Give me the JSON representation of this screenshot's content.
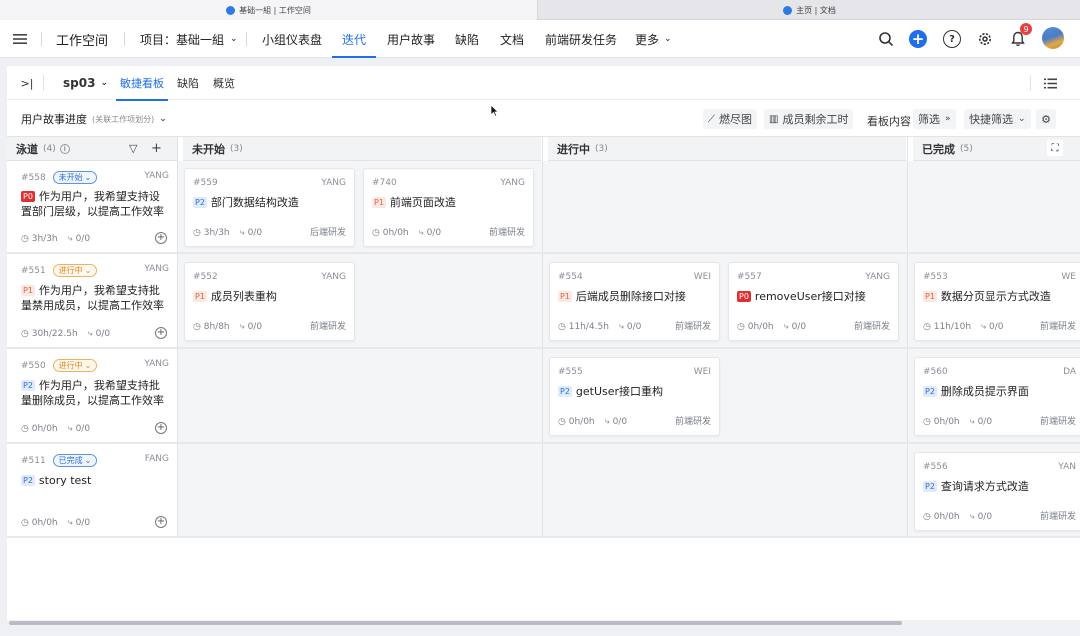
{
  "browser_tabs": [
    {
      "title": "基础一組 | 工作空间"
    },
    {
      "title": "主页 | 文档"
    }
  ],
  "header": {
    "app_title": "工作空间",
    "project_label": "项目：基础一組",
    "nav": [
      {
        "label": "小组仪表盘"
      },
      {
        "label": "迭代"
      },
      {
        "label": "用户故事"
      },
      {
        "label": "缺陷"
      },
      {
        "label": "文档"
      },
      {
        "label": "前端研发任务"
      },
      {
        "label": "更多"
      }
    ],
    "notification_count": "9"
  },
  "subnav": {
    "sprint": "sp03",
    "tabs": [
      {
        "label": "敏捷看板"
      },
      {
        "label": "缺陷"
      },
      {
        "label": "概览"
      }
    ]
  },
  "toolbar": {
    "view_title": "用户故事进度",
    "view_subtitle": "(关联工作项划分)",
    "burndown": "燃尽图",
    "remaining_hours": "成员剩余工时",
    "board_content_label": "看板内容",
    "filter": "筛选",
    "quick_filter": "快捷筛选"
  },
  "board": {
    "lane_header": {
      "label": "泳道",
      "count": "(4)"
    },
    "columns": [
      {
        "label": "未开始",
        "count": "(3)"
      },
      {
        "label": "进行中",
        "count": "(3)"
      },
      {
        "label": "已完成",
        "count": "(5)"
      }
    ],
    "lanes": [
      {
        "id": "#558",
        "status": "未开始",
        "owner": "YANG",
        "priority": "P0",
        "title": "作为用户，我希望支持设置部门层级，以提高工作效率",
        "hours": "3h/3h",
        "subtasks": "0/0"
      },
      {
        "id": "#551",
        "status": "进行中",
        "owner": "YANG",
        "priority": "P1",
        "title": "作为用户，我希望支持批量禁用成员，以提高工作效率",
        "hours": "30h/22.5h",
        "subtasks": "0/0"
      },
      {
        "id": "#550",
        "status": "进行中",
        "owner": "YANG",
        "priority": "P2",
        "title": "作为用户，我希望支持批量删除成员，以提高工作效率",
        "hours": "0h/0h",
        "subtasks": "0/0"
      },
      {
        "id": "#511",
        "status": "已完成",
        "owner": "FANG",
        "priority": "P2",
        "title": "story test",
        "hours": "0h/0h",
        "subtasks": "0/0"
      }
    ],
    "cards": [
      {
        "id": "#559",
        "owner": "YANG",
        "priority": "P2",
        "title": "部门数据结构改造",
        "hours": "3h/3h",
        "subtasks": "0/0",
        "team": "后端研发"
      },
      {
        "id": "#740",
        "owner": "YANG",
        "priority": "P1",
        "title": "前端页面改造",
        "hours": "0h/0h",
        "subtasks": "0/0",
        "team": "前端研发"
      },
      {
        "id": "#552",
        "owner": "YANG",
        "priority": "P1",
        "title": "成员列表重构",
        "hours": "8h/8h",
        "subtasks": "0/0",
        "team": "前端研发"
      },
      {
        "id": "#554",
        "owner": "WEI",
        "priority": "P1",
        "title": "后端成员删除接口对接",
        "hours": "11h/4.5h",
        "subtasks": "0/0",
        "team": "前端研发"
      },
      {
        "id": "#557",
        "owner": "YANG",
        "priority": "P0",
        "title": "removeUser接口对接",
        "hours": "0h/0h",
        "subtasks": "0/0",
        "team": "前端研发"
      },
      {
        "id": "#553",
        "owner": "WE",
        "priority": "P1",
        "title": "数据分页显示方式改造",
        "hours": "11h/10h",
        "subtasks": "0/0",
        "team": "前端研发"
      },
      {
        "id": "#555",
        "owner": "WEI",
        "priority": "P2",
        "title": "getUser接口重构",
        "hours": "0h/0h",
        "subtasks": "0/0",
        "team": "前端研发"
      },
      {
        "id": "#560",
        "owner": "DA",
        "priority": "P2",
        "title": "删除成员提示界面",
        "hours": "0h/0h",
        "subtasks": "0/0",
        "team": "前端研发"
      },
      {
        "id": "#556",
        "owner": "YAN",
        "priority": "P2",
        "title": "查询请求方式改造",
        "hours": "0h/0h",
        "subtasks": "0/0",
        "team": "前端研发"
      }
    ]
  },
  "colors": {
    "accent": "#1e6fe8",
    "p0": "#e02f2f",
    "p1": "#e0673c",
    "p2": "#2f6fd8",
    "in_progress": "#e08a1a"
  }
}
